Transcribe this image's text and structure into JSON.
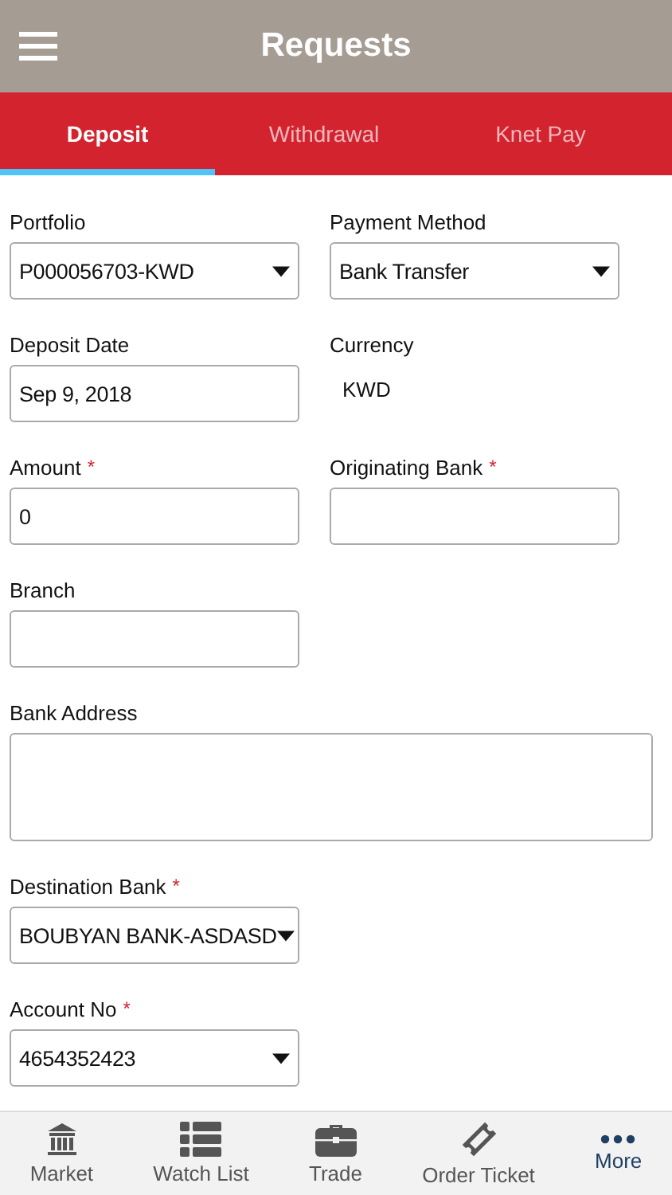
{
  "header": {
    "title": "Requests"
  },
  "tabs": [
    {
      "label": "Deposit",
      "selected": true
    },
    {
      "label": "Withdrawal",
      "selected": false
    },
    {
      "label": "Knet Pay",
      "selected": false
    }
  ],
  "form_rows": [
    {
      "fields": [
        {
          "label": "Portfolio",
          "kind": "select",
          "value": "P000056703-KWD"
        },
        {
          "label": "Payment Method",
          "kind": "select",
          "value": "Bank Transfer"
        }
      ]
    },
    {
      "fields": [
        {
          "label": "Deposit Date",
          "kind": "input",
          "value": "Sep 9, 2018"
        },
        {
          "label": "Currency",
          "kind": "text",
          "value": "KWD"
        }
      ]
    },
    {
      "fields": [
        {
          "label": "Amount",
          "required_mark": "*",
          "kind": "input",
          "value": "0"
        },
        {
          "label": "Originating Bank",
          "required_mark": "*",
          "kind": "input"
        }
      ]
    },
    {
      "fields": [
        {
          "label": "Branch",
          "kind": "input"
        }
      ]
    },
    {
      "fields": [
        {
          "label": "Bank Address",
          "kind": "textarea"
        }
      ]
    },
    {
      "fields": [
        {
          "label": "Destination Bank",
          "required_mark": "*",
          "kind": "select",
          "value": "BOUBYAN BANK-ASDASD"
        }
      ]
    },
    {
      "fields": [
        {
          "label": "Account No",
          "required_mark": "*",
          "kind": "select",
          "value": "4654352423"
        }
      ]
    }
  ],
  "tab_bar": [
    {
      "label": "Market",
      "selected": false
    },
    {
      "label": "Watch List",
      "selected": false
    },
    {
      "label": "Trade",
      "selected": false
    },
    {
      "label": "Order Ticket",
      "selected": false
    },
    {
      "label": "More",
      "selected": true
    }
  ]
}
